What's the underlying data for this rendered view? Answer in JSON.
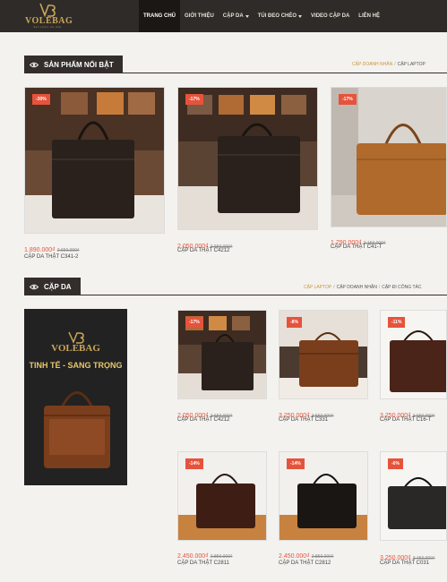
{
  "header": {
    "logo_text": "VOLEBAG",
    "logo_tagline": "Sản phẩm da thật",
    "nav": [
      {
        "label": "Trang chủ",
        "active": true
      },
      {
        "label": "Giới thiệu"
      },
      {
        "label": "Cặp da",
        "dropdown": true
      },
      {
        "label": "Túi đeo chéo",
        "dropdown": true
      },
      {
        "label": "Video cặp da"
      },
      {
        "label": "Liên hệ"
      }
    ]
  },
  "featured": {
    "title": "Sản phẩm nổi bật",
    "links": [
      {
        "label": "Cặp doanh nhân",
        "active": true
      },
      {
        "label": "Cặp laptop"
      }
    ],
    "products": [
      {
        "badge": "-30%",
        "price": "1.890.000₫",
        "old_price": "2.650.000₫",
        "name": "Cặp da thật C341-2"
      },
      {
        "badge": "-17%",
        "price": "2.050.000₫",
        "old_price": "2.650.000₫",
        "name": "Cặp da thật C4212"
      },
      {
        "badge": "-17%",
        "price": "1.790.000₫",
        "old_price": "2.150.000₫",
        "name": "Cặp da thật C41-T"
      }
    ]
  },
  "cap_da": {
    "title": "Cặp da",
    "links": [
      {
        "label": "Cặp laptop",
        "active": true
      },
      {
        "label": "Cặp doanh nhân"
      },
      {
        "label": "Cặp đi công tác"
      }
    ],
    "banner": {
      "brand": "VOLEBAG",
      "slogan": "TINH TẾ - SANG TRỌNG"
    },
    "products": [
      {
        "badge": "-17%",
        "price": "2.050.000₫",
        "old_price": "2.650.000₫",
        "name": "Cặp da thật C4212"
      },
      {
        "badge": "-8%",
        "price": "3.250.000₫",
        "old_price": "3.550.000₫",
        "name": "Cặp da thật C331"
      },
      {
        "badge": "-11%",
        "price": "3.250.000₫",
        "old_price": "3.650.000₫",
        "name": "Cặp da thật C16-T"
      },
      {
        "badge": "-14%",
        "price": "2.450.000₫",
        "old_price": "2.850.000₫",
        "name": "Cặp da thật C2811"
      },
      {
        "badge": "-14%",
        "price": "2.450.000₫",
        "old_price": "2.850.000₫",
        "name": "Cặp da thật C2812"
      },
      {
        "badge": "-6%",
        "price": "3.250.000₫",
        "old_price": "3.450.000₫",
        "name": "Cặp da thật C031"
      }
    ]
  },
  "colors": {
    "header_bg": "#2f2b28",
    "accent": "#c9953a",
    "sale": "#e6533c",
    "section_bg": "#332e2b"
  }
}
